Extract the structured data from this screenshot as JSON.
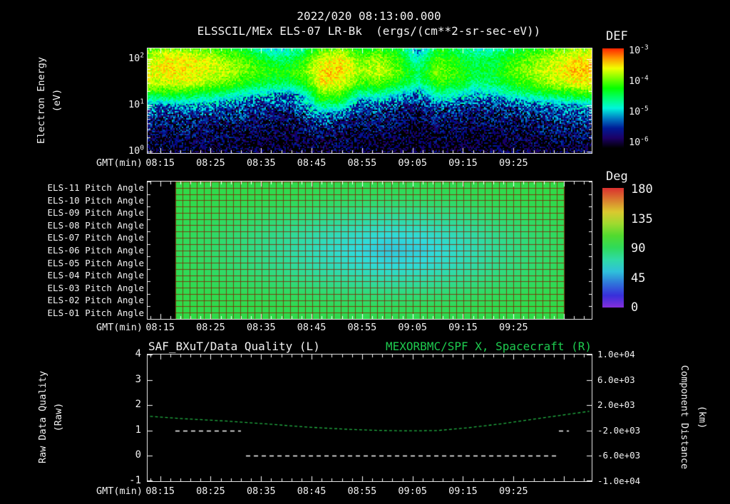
{
  "colors": {
    "background": "#000000",
    "text": "#f2f2f2",
    "title_green": "#1ecb4f",
    "curve_green": "#22b544",
    "quality_white": "#ffffff",
    "pitch_grid_line": "rgba(130,32,0,0.8)"
  },
  "time_axis": {
    "label": "GMT(min)",
    "start": "08:13",
    "ticks": [
      "08:15",
      "08:25",
      "08:35",
      "08:45",
      "08:55",
      "09:05",
      "09:15",
      "09:25"
    ],
    "minor_step_min": 2
  },
  "chart_data": [
    {
      "type": "heatmap",
      "name": "electron-energy-spectrogram",
      "title": "2022/020 08:13:00.000",
      "subtitle": "ELSSCIL/MEx ELS-07 LR-Bk  (ergs/(cm**2-sr-sec-eV))",
      "ylabel": [
        "Electron Energy",
        "(eV)"
      ],
      "yscale": "log",
      "yticks": [
        "10^0",
        "10^1",
        "10^2"
      ],
      "colorbar": {
        "label": "DEF",
        "ticks": [
          "10^-3",
          "10^-4",
          "10^-5",
          "10^-6"
        ],
        "colormap": "rainbow"
      },
      "x_start": "08:13",
      "x_end": "09:40",
      "value_units": "log10 ergs/(cm**2-sr-sec-eV)",
      "row_log10_energy_top_to_bottom": [
        2.1,
        1.85,
        1.6,
        1.35,
        1.1,
        0.85,
        0.6,
        0.35,
        0.1,
        -0.1
      ],
      "columns": [
        [
          -4.2,
          -3.9,
          -3.8,
          -3.9,
          -4.6,
          -5.4,
          -5.8,
          -6.0,
          -6.2,
          -6.3
        ],
        [
          -4.0,
          -3.7,
          -3.7,
          -3.9,
          -4.5,
          -5.5,
          -5.8,
          -6.1,
          -6.2,
          -6.3
        ],
        [
          -4.1,
          -3.7,
          -3.7,
          -3.8,
          -4.6,
          -5.4,
          -5.9,
          -6.0,
          -6.2,
          -6.3
        ],
        [
          -4.2,
          -3.8,
          -3.8,
          -4.0,
          -4.7,
          -5.5,
          -5.8,
          -6.1,
          -6.2,
          -6.3
        ],
        [
          -4.4,
          -4.0,
          -3.9,
          -4.2,
          -4.9,
          -5.6,
          -5.9,
          -6.1,
          -6.2,
          -6.3
        ],
        [
          -4.6,
          -4.2,
          -4.1,
          -4.4,
          -5.1,
          -5.7,
          -5.9,
          -6.1,
          -6.3,
          -6.3
        ],
        [
          -5.0,
          -4.5,
          -4.3,
          -4.6,
          -5.3,
          -5.8,
          -6.0,
          -6.2,
          -6.3,
          -6.4
        ],
        [
          -5.1,
          -4.7,
          -4.4,
          -4.7,
          -5.4,
          -5.8,
          -6.0,
          -6.2,
          -6.3,
          -6.4
        ],
        [
          -4.8,
          -4.4,
          -4.2,
          -4.5,
          -5.2,
          -5.6,
          -5.9,
          -6.1,
          -6.2,
          -6.3
        ],
        [
          -4.2,
          -3.8,
          -3.6,
          -3.7,
          -4.2,
          -4.8,
          -5.6,
          -6.0,
          -6.2,
          -6.3
        ],
        [
          -4.1,
          -3.7,
          -3.6,
          -3.8,
          -4.3,
          -4.9,
          -5.7,
          -6.1,
          -6.2,
          -6.3
        ],
        [
          -4.5,
          -4.1,
          -4.0,
          -4.3,
          -5.0,
          -5.7,
          -6.0,
          -6.2,
          -6.3,
          -6.4
        ],
        [
          -4.3,
          -4.0,
          -3.9,
          -4.2,
          -4.9,
          -5.6,
          -5.9,
          -6.1,
          -6.3,
          -6.3
        ],
        [
          -4.6,
          -4.3,
          -4.2,
          -4.5,
          -5.2,
          -5.8,
          -6.1,
          -6.2,
          -6.3,
          -6.4
        ],
        [
          -5.4,
          -5.0,
          -4.7,
          -4.9,
          -5.5,
          -5.9,
          -6.2,
          -6.3,
          -6.4,
          -6.4
        ],
        [
          -4.5,
          -4.2,
          -4.1,
          -4.3,
          -4.9,
          -5.6,
          -6.0,
          -6.2,
          -6.3,
          -6.3
        ],
        [
          -4.7,
          -4.4,
          -4.3,
          -4.5,
          -5.1,
          -5.7,
          -6.0,
          -6.2,
          -6.3,
          -6.4
        ],
        [
          -5.0,
          -4.7,
          -4.6,
          -4.8,
          -5.3,
          -5.8,
          -6.1,
          -6.2,
          -6.3,
          -6.4
        ],
        [
          -4.9,
          -4.6,
          -4.5,
          -4.7,
          -5.2,
          -5.8,
          -6.0,
          -6.2,
          -6.3,
          -6.3
        ],
        [
          -4.6,
          -4.3,
          -4.2,
          -4.4,
          -5.0,
          -5.7,
          -6.0,
          -6.1,
          -6.3,
          -6.3
        ],
        [
          -4.4,
          -4.1,
          -4.0,
          -4.2,
          -4.8,
          -5.6,
          -5.9,
          -6.1,
          -6.2,
          -6.3
        ],
        [
          -4.2,
          -3.9,
          -3.8,
          -4.0,
          -4.6,
          -5.5,
          -5.8,
          -6.0,
          -6.2,
          -6.3
        ],
        [
          -4.0,
          -3.7,
          -3.6,
          -3.8,
          -4.5,
          -5.4,
          -5.8,
          -6.0,
          -6.2,
          -6.3
        ],
        [
          -3.9,
          -3.6,
          -3.6,
          -3.7,
          -4.4,
          -5.3,
          -5.7,
          -6.0,
          -6.1,
          -6.2
        ]
      ]
    },
    {
      "type": "heatmap",
      "name": "pitch-angle-panel",
      "row_labels": [
        "ELS-11 Pitch Angle",
        "ELS-10 Pitch Angle",
        "ELS-09 Pitch Angle",
        "ELS-08 Pitch Angle",
        "ELS-07 Pitch Angle",
        "ELS-06 Pitch Angle",
        "ELS-05 Pitch Angle",
        "ELS-04 Pitch Angle",
        "ELS-03 Pitch Angle",
        "ELS-02 Pitch Angle",
        "ELS-01 Pitch Angle"
      ],
      "colorbar": {
        "label": "Deg",
        "ticks": [
          180,
          135,
          90,
          45,
          0
        ],
        "colormap": "rainbow"
      },
      "data_start": "08:18",
      "data_end": "09:35",
      "col_times": [
        "08:18",
        "08:25",
        "08:32",
        "08:39",
        "08:46",
        "08:53",
        "09:00",
        "09:07",
        "09:14",
        "09:21",
        "09:28",
        "09:35"
      ],
      "values_deg": [
        [
          95,
          94,
          93,
          92,
          91,
          90,
          91,
          92,
          93,
          94,
          95
        ],
        [
          94,
          93,
          92,
          89,
          87,
          86,
          87,
          89,
          92,
          93,
          94
        ],
        [
          94,
          93,
          90,
          86,
          82,
          81,
          82,
          86,
          90,
          93,
          94
        ],
        [
          94,
          92,
          88,
          82,
          77,
          75,
          77,
          82,
          88,
          92,
          94
        ],
        [
          93,
          90,
          85,
          77,
          70,
          67,
          70,
          77,
          85,
          90,
          93
        ],
        [
          93,
          89,
          82,
          73,
          64,
          60,
          64,
          73,
          82,
          89,
          93
        ],
        [
          93,
          88,
          80,
          69,
          59,
          55,
          59,
          69,
          80,
          88,
          93
        ],
        [
          93,
          89,
          81,
          71,
          61,
          57,
          61,
          71,
          81,
          89,
          93
        ],
        [
          93,
          90,
          84,
          76,
          68,
          65,
          68,
          76,
          84,
          90,
          93
        ],
        [
          94,
          92,
          88,
          82,
          77,
          75,
          77,
          82,
          88,
          92,
          94
        ],
        [
          94,
          93,
          91,
          87,
          84,
          83,
          84,
          87,
          91,
          93,
          94
        ],
        [
          95,
          94,
          93,
          91,
          90,
          89,
          90,
          91,
          93,
          94,
          95
        ]
      ]
    },
    {
      "type": "line",
      "name": "quality-and-spacecraft-x",
      "title_left": "SAF_BXuT/Data Quality (L)",
      "title_right": "MEXORBMC/SPF X, Spacecraft (R)",
      "left_axis": {
        "label": [
          "Raw Data Quality",
          "(Raw)"
        ],
        "ticks": [
          4,
          3,
          2,
          1,
          0,
          -1
        ],
        "range": [
          -1,
          4
        ]
      },
      "right_axis": {
        "label": [
          "Component Distance",
          "(km)"
        ],
        "ticks": [
          "1.0e+04",
          "6.0e+03",
          "2.0e+03",
          "-2.0e+03",
          "-6.0e+03",
          "-1.0e+04"
        ],
        "range": [
          -10000,
          10000
        ]
      },
      "series": [
        {
          "name": "SAF_BXuT/Data Quality",
          "axis": "left",
          "style": "dashed",
          "color": "#ffffff",
          "segments": [
            [
              "08:18",
              "08:31",
              1
            ],
            [
              "08:32",
              "09:34",
              0
            ],
            [
              "09:34",
              "09:36",
              1
            ]
          ]
        },
        {
          "name": "MEXORBMC/SPF X Spacecraft",
          "axis": "right",
          "style": "dashed",
          "color": "#22b544",
          "points": [
            [
              "08:13",
              250
            ],
            [
              "08:20",
              -150
            ],
            [
              "08:28",
              -500
            ],
            [
              "08:36",
              -950
            ],
            [
              "08:44",
              -1450
            ],
            [
              "08:52",
              -1800
            ],
            [
              "08:58",
              -1980
            ],
            [
              "09:04",
              -2050
            ],
            [
              "09:10",
              -2000
            ],
            [
              "09:16",
              -1560
            ],
            [
              "09:22",
              -1000
            ],
            [
              "09:28",
              -320
            ],
            [
              "09:34",
              360
            ],
            [
              "09:40",
              1040
            ]
          ]
        }
      ]
    }
  ]
}
